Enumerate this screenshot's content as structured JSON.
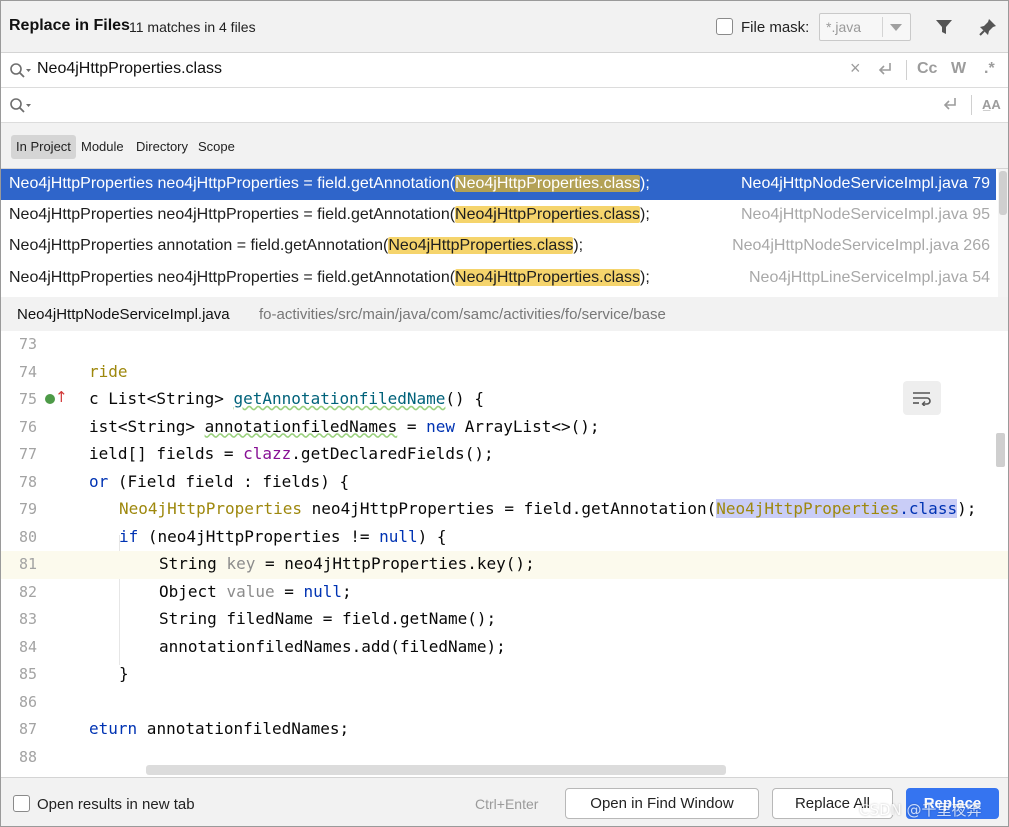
{
  "header": {
    "title": "Replace in Files",
    "matches": "11 matches in 4 files",
    "file_mask_label": "File mask:",
    "file_mask_value": "*.java",
    "file_mask_checked": false
  },
  "search": {
    "find_text": "Neo4jHttpProperties.class",
    "replace_text": "",
    "options": {
      "case": "Cc",
      "words": "W",
      "regex": ".*",
      "preserve_case": "A̲A"
    }
  },
  "scope_tabs": [
    {
      "label": "In Project",
      "active": true
    },
    {
      "label": "Module",
      "active": false
    },
    {
      "label": "Directory",
      "active": false
    },
    {
      "label": "Scope",
      "active": false
    }
  ],
  "results": [
    {
      "prefix": "Neo4jHttpProperties neo4jHttpProperties = field.getAnnotation(",
      "match": "Neo4jHttpProperties.class",
      "suffix": ");",
      "file": "Neo4jHttpNodeServiceImpl.java 79",
      "selected": true
    },
    {
      "prefix": "Neo4jHttpProperties neo4jHttpProperties = field.getAnnotation(",
      "match": "Neo4jHttpProperties.class",
      "suffix": ");",
      "file": "Neo4jHttpNodeServiceImpl.java 95",
      "selected": false
    },
    {
      "prefix": "Neo4jHttpProperties annotation = field.getAnnotation(",
      "match": "Neo4jHttpProperties.class",
      "suffix": ");",
      "file": "Neo4jHttpNodeServiceImpl.java 266",
      "selected": false
    },
    {
      "prefix": "Neo4jHttpProperties neo4jHttpProperties = field.getAnnotation(",
      "match": "Neo4jHttpProperties.class",
      "suffix": ");",
      "file": "Neo4jHttpLineServiceImpl.java 54",
      "selected": false
    }
  ],
  "preview": {
    "file_name": "Neo4jHttpNodeServiceImpl.java",
    "file_path": "fo-activities/src/main/java/com/samc/activities/fo/service/base"
  },
  "code_lines": [
    {
      "num": "73"
    },
    {
      "num": "74"
    },
    {
      "num": "75"
    },
    {
      "num": "76"
    },
    {
      "num": "77"
    },
    {
      "num": "78"
    },
    {
      "num": "79"
    },
    {
      "num": "80"
    },
    {
      "num": "81"
    },
    {
      "num": "82"
    },
    {
      "num": "83"
    },
    {
      "num": "84"
    },
    {
      "num": "85"
    },
    {
      "num": "86"
    },
    {
      "num": "87"
    },
    {
      "num": "88"
    }
  ],
  "code": {
    "l74": "ride",
    "l75_a": "c List<String> ",
    "l75_fn": "getAnnotationfiledName",
    "l75_b": "() {",
    "l76_a": "ist<String> ",
    "l76_var": "annotationfiledNames",
    "l76_b": " = ",
    "l76_new": "new",
    "l76_c": " ArrayList<>();",
    "l77_a": "ield[] fields = ",
    "l77_fld": "clazz",
    "l77_b": ".getDeclaredFields();",
    "l78_kw": "or",
    "l78_b": " (Field field : fields) {",
    "l79_ann": "Neo4jHttpProperties",
    "l79_b": " neo4jHttpProperties = field.getAnnotation(",
    "l79_m1": "Neo4jHttpProperties",
    "l79_m2": ".class",
    "l79_c": ");",
    "l80_kw": "if",
    "l80_b": " (neo4jHttpProperties != ",
    "l80_null": "null",
    "l80_c": ") {",
    "l81_a": "String ",
    "l81_g": "key",
    "l81_b": " = neo4jHttpProperties.key();",
    "l82_a": "Object ",
    "l82_g": "value",
    "l82_b": " = ",
    "l82_null": "null",
    "l82_c": ";",
    "l83": "String filedName = field.getName();",
    "l84": "annotationfiledNames.add(filedName);",
    "l85": "}",
    "l87_kw": "eturn",
    "l87_b": " annotationfiledNames;"
  },
  "footer": {
    "open_new_tab_label": "Open results in new tab",
    "shortcut": "Ctrl+Enter",
    "open_find_window": "Open in Find Window",
    "replace_all": "Replace All",
    "replace": "Replace",
    "watermark": "CSDN @千里夜奔"
  },
  "colors": {
    "selection": "#2f65ca",
    "match_highlight": "#f5d46c",
    "primary_button": "#3574f0"
  }
}
